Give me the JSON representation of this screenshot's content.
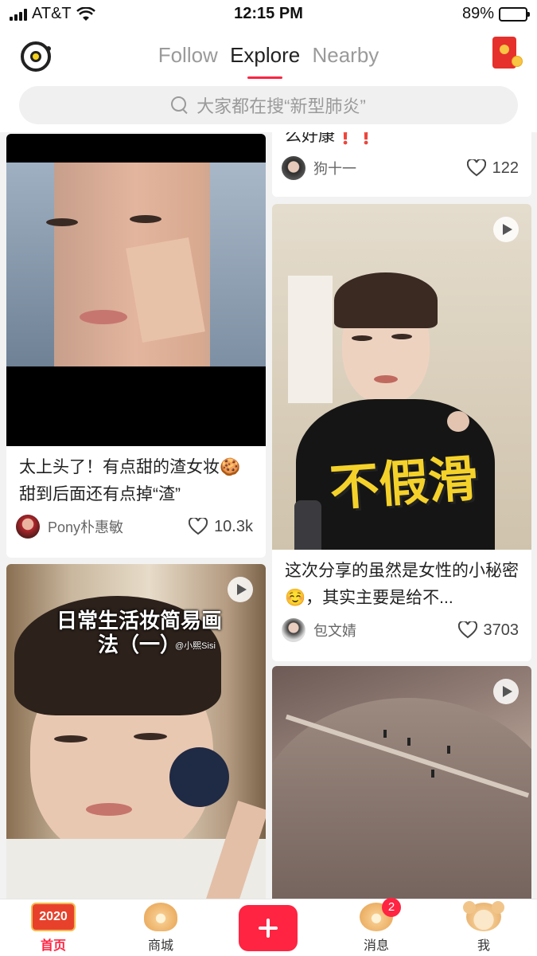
{
  "status_bar": {
    "carrier": "AT&T",
    "time": "12:15 PM",
    "battery": "89%",
    "battery_level": 0.89
  },
  "header": {
    "tabs": [
      {
        "label": "Follow",
        "active": false
      },
      {
        "label": "Explore",
        "active": true
      },
      {
        "label": "Nearby",
        "active": false
      }
    ],
    "search_placeholder": "大家都在搜“新型肺炎”"
  },
  "feed": {
    "left": [
      {
        "title": "太上头了！有点甜的渣女妆🍪甜到后面还有点掉“渣”",
        "author": "Pony朴惠敏",
        "likes": "10.3k",
        "video": false
      },
      {
        "image_text": "日常生活妆简易画法（一）",
        "watermark": "@小熙Sisi",
        "video": true
      }
    ],
    "right": [
      {
        "title": "么好康❗❗",
        "author": "狗十一",
        "likes": "122",
        "video": false
      },
      {
        "image_text": "不假滑",
        "title": "这次分享的虽然是女性的小秘密☺️，其实主要是给不...",
        "author": "包文婧",
        "likes": "3703",
        "video": true
      },
      {
        "video": true
      }
    ]
  },
  "bottom_nav": {
    "items": [
      {
        "label": "首页",
        "icon": "home-2020-icon",
        "active": true
      },
      {
        "label": "商城",
        "icon": "shop-jar-icon",
        "active": false
      },
      {
        "label": "",
        "icon": "plus-icon",
        "active": false
      },
      {
        "label": "消息",
        "icon": "message-icon",
        "badge": "2",
        "active": false
      },
      {
        "label": "我",
        "icon": "profile-mouse-icon",
        "active": false
      }
    ],
    "home_badge_text": "2020"
  },
  "colors": {
    "accent": "#ff2442"
  }
}
